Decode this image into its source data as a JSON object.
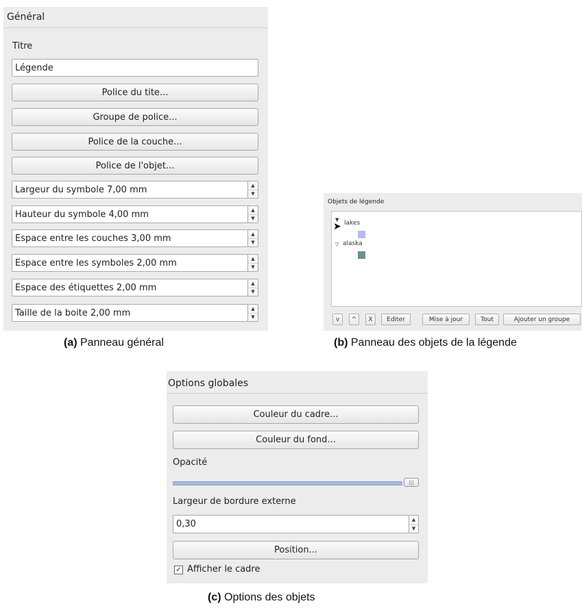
{
  "panel_a": {
    "header": "Général",
    "title_label": "Titre",
    "title_value": "Légende",
    "buttons": [
      "Police du tite...",
      "Groupe de police...",
      "Police de la couche...",
      "Police de l'objet..."
    ],
    "spinners": [
      "Largeur du symbole 7,00 mm",
      "Hauteur du symbole 4,00 mm",
      "Espace entre les couches 3,00 mm",
      "Espace entre les symboles 2,00 mm",
      "Espace des étiquettes 2,00 mm",
      "Taille de la boite 2,00 mm"
    ],
    "caption_bold": "(a)",
    "caption_text": " Panneau général"
  },
  "panel_b": {
    "header": "Objets de légende",
    "tree": [
      {
        "label": "lakes",
        "color": "#b9b9f2"
      },
      {
        "label": "alaska",
        "color": "#6f8f8f"
      }
    ],
    "buttons": [
      "v",
      "^",
      "X",
      "Editer",
      "Mise à jour",
      "Tout",
      "Ajouter un groupe"
    ],
    "caption_bold": "(b)",
    "caption_text": " Panneau des objets de la légende"
  },
  "panel_c": {
    "header": "Options globales",
    "frame_color_button": "Couleur du cadre...",
    "bg_color_button": "Couleur du fond...",
    "opacity_label": "Opacité",
    "opacity_value": 1.0,
    "outer_border_label": "Largeur de bordure externe",
    "outer_border_value": "0,30",
    "position_button": "Position...",
    "show_frame_label": "Afficher le cadre",
    "show_frame_checked": true,
    "caption_bold": "(c)",
    "caption_text": " Options des objets"
  },
  "colors": {
    "panel_bg": "#ececec",
    "slider_fill": "#9fbfe4"
  }
}
